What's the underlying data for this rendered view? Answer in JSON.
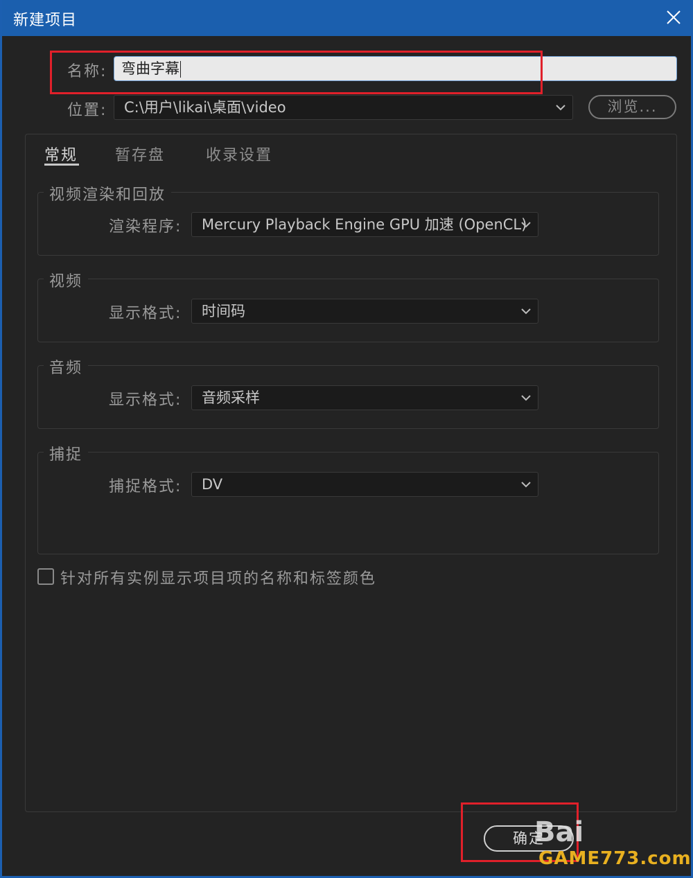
{
  "window": {
    "title": "新建项目",
    "close_icon": "close-icon"
  },
  "form": {
    "name_label": "名称:",
    "name_value": "弯曲字幕",
    "location_label": "位置:",
    "location_value": "C:\\用户\\likai\\桌面\\video",
    "browse_label": "浏览..."
  },
  "tabs": [
    {
      "label": "常规",
      "active": true
    },
    {
      "label": "暂存盘",
      "active": false
    },
    {
      "label": "收录设置",
      "active": false
    }
  ],
  "groups": {
    "render": {
      "title": "视频渲染和回放",
      "field_label": "渲染程序:",
      "field_value": "Mercury Playback Engine GPU 加速 (OpenCL)"
    },
    "video": {
      "title": "视频",
      "field_label": "显示格式:",
      "field_value": "时间码"
    },
    "audio": {
      "title": "音频",
      "field_label": "显示格式:",
      "field_value": "音频采样"
    },
    "capture": {
      "title": "捕捉",
      "field_label": "捕捉格式:",
      "field_value": "DV"
    }
  },
  "checkbox": {
    "label": "针对所有实例显示项目项的名称和标签颜色",
    "checked": false
  },
  "buttons": {
    "ok_label": "确定"
  },
  "watermark": {
    "baidu": "Bai",
    "game": "GAME773.com"
  },
  "colors": {
    "title_bar": "#1b5fae",
    "highlight": "#e0202a",
    "background": "#232323"
  }
}
